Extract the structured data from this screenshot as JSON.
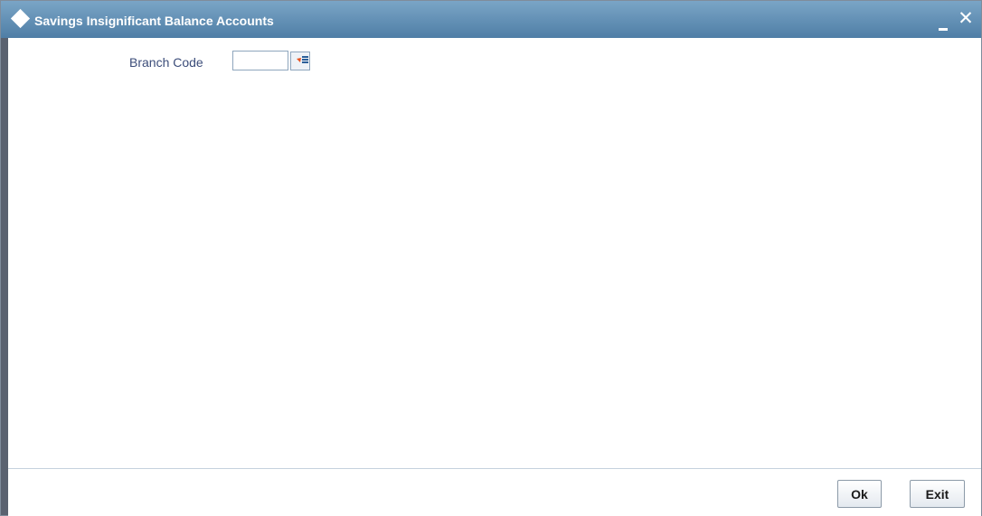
{
  "window": {
    "title": "Savings Insignificant Balance Accounts",
    "minimize_glyph": "–",
    "close_glyph": "✕"
  },
  "form": {
    "branch_code_label": "Branch Code",
    "branch_code_value": "",
    "lov_icon": "list-of-values-icon"
  },
  "footer": {
    "ok_label": "Ok",
    "exit_label": "Exit"
  },
  "colors": {
    "titlebar": "#5f8db3",
    "label_text": "#3c4d7a",
    "lov_arrow": "#e8521f",
    "lov_lines": "#2b5f99"
  }
}
